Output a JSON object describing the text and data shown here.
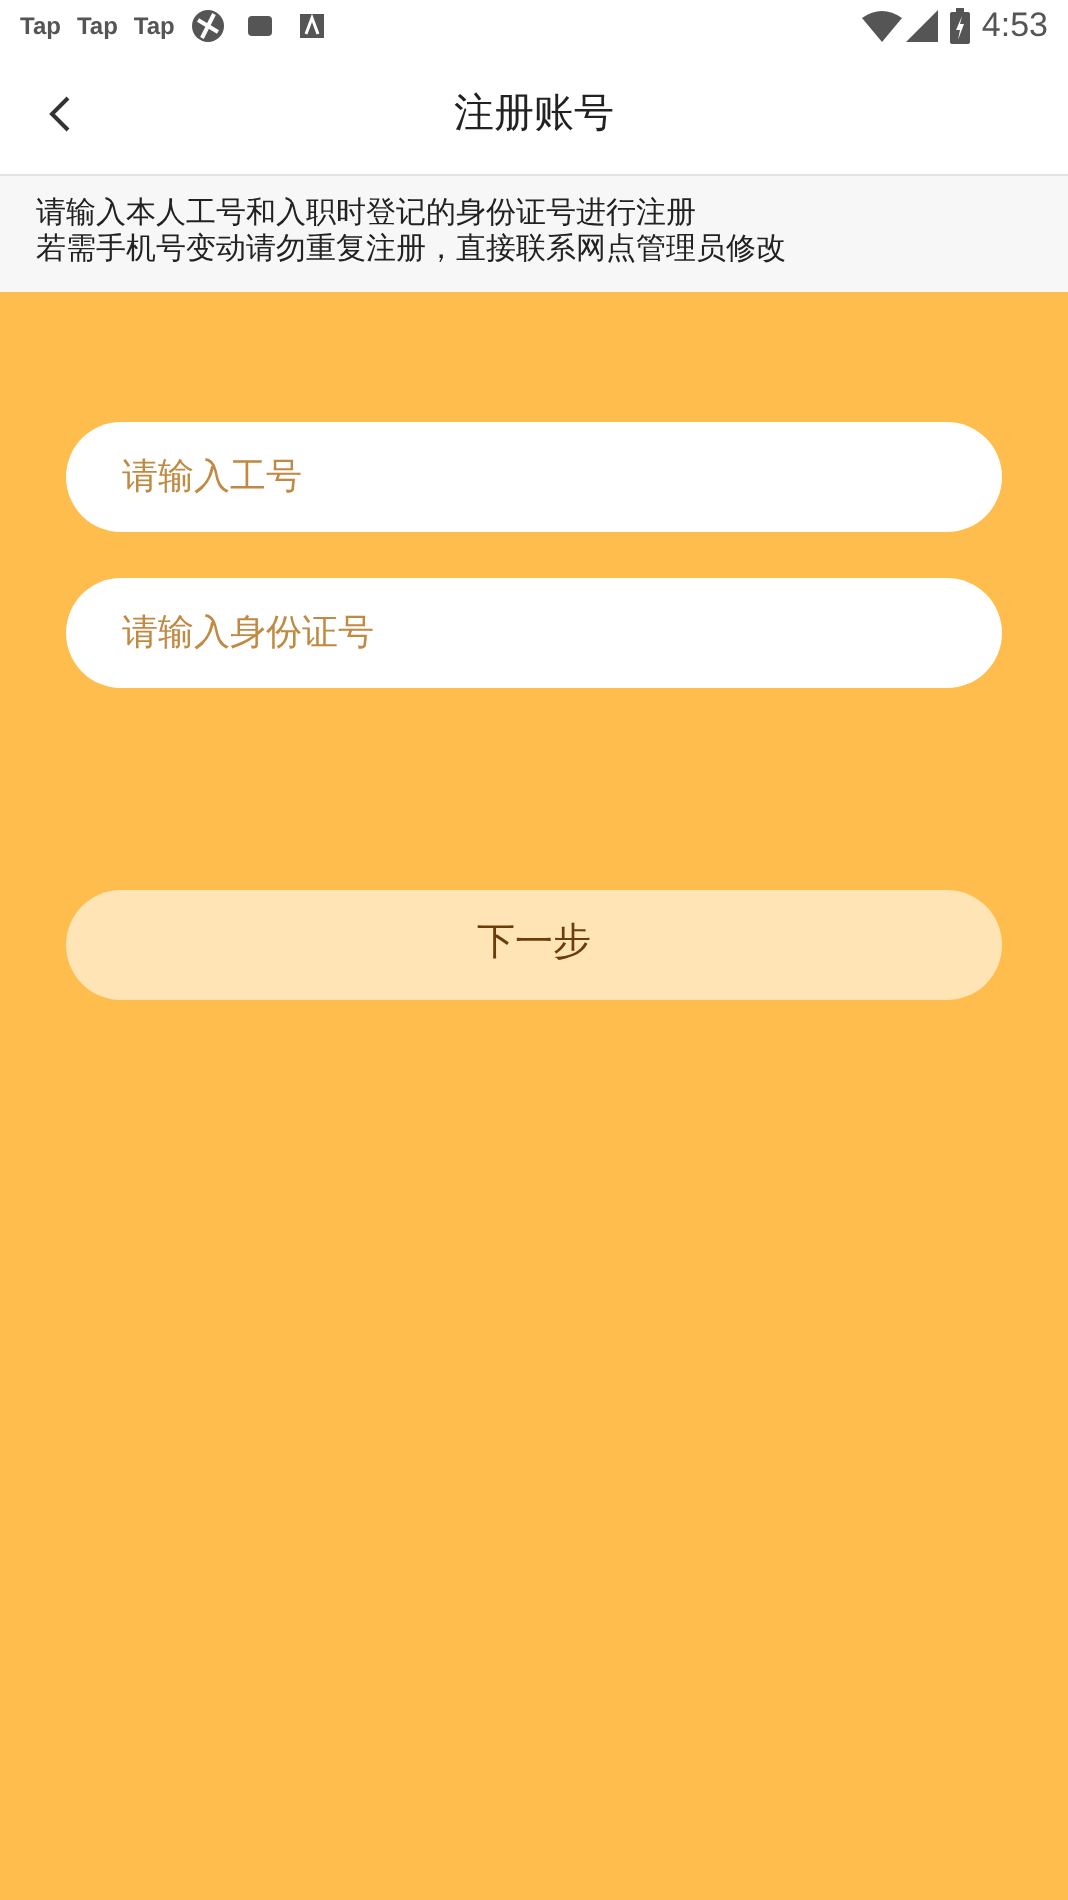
{
  "status_bar": {
    "notifications": [
      "Tap",
      "Tap",
      "Tap"
    ],
    "time": "4:53"
  },
  "header": {
    "title": "注册账号"
  },
  "notice": [
    "请输入本人工号和入职时登记的身份证号进行注册",
    "若需手机号变动请勿重复注册，直接联系网点管理员修改"
  ],
  "fields": [
    {
      "placeholder": "请输入工号"
    },
    {
      "placeholder": "请输入身份证号"
    }
  ],
  "next_button": {
    "label": "下一步",
    "disabled": true
  }
}
